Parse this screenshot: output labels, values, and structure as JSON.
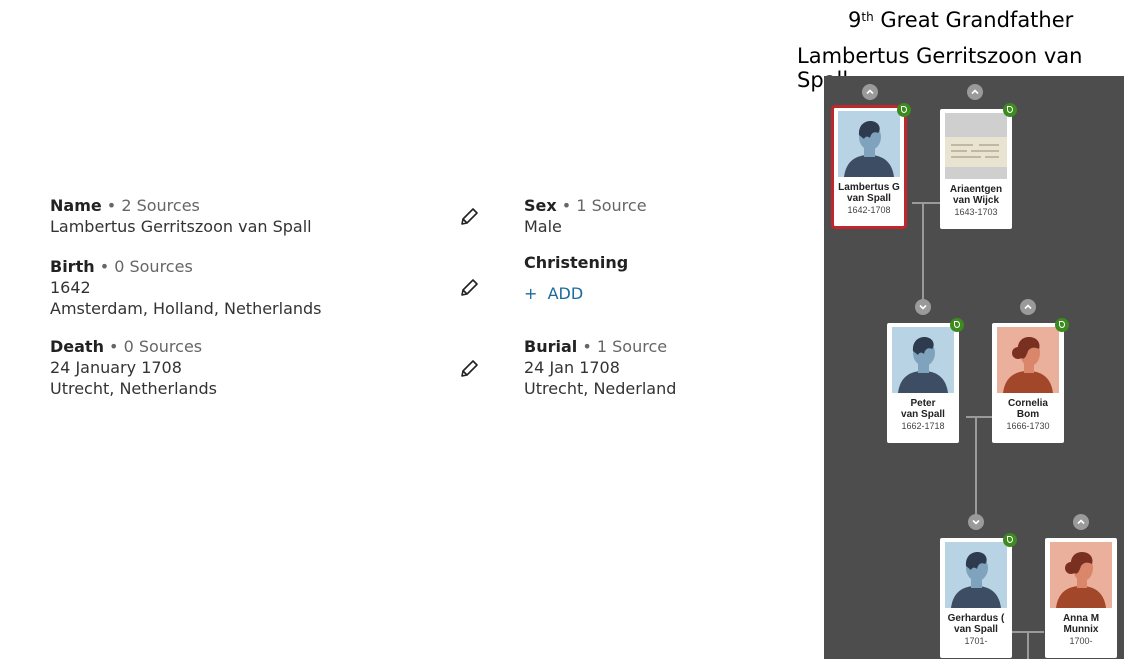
{
  "header": {
    "relation_number": "9",
    "relation_suffix": "th",
    "relation_rest": " Great Grandfather",
    "person_name": "Lambertus Gerritszoon van Spall"
  },
  "facts": {
    "name": {
      "label": "Name",
      "sources": " • 2 Sources",
      "value": "Lambertus Gerritszoon van Spall"
    },
    "birth": {
      "label": "Birth",
      "sources": " • 0 Sources",
      "date": "1642",
      "place": "Amsterdam, Holland, Netherlands"
    },
    "death": {
      "label": "Death",
      "sources": " • 0 Sources",
      "date": "24 January 1708",
      "place": "Utrecht, Netherlands"
    },
    "sex": {
      "label": "Sex",
      "sources": " • 1 Source",
      "value": "Male"
    },
    "christening": {
      "label": "Christening",
      "add_label": "+  ADD"
    },
    "burial": {
      "label": "Burial",
      "sources": " • 1 Source",
      "date": "24 Jan 1708",
      "place": "Utrecht, Nederland"
    }
  },
  "tree": {
    "cards": [
      {
        "line1": "Lambertus G",
        "line2": "van Spall",
        "years": "1642-1708",
        "gender": "male",
        "selected": true
      },
      {
        "line1": "Ariaentgen",
        "line2": "van Wijck",
        "years": "1643-1703",
        "gender": "document"
      },
      {
        "line1": "Peter",
        "line2": "van Spall",
        "years": "1662-1718",
        "gender": "male"
      },
      {
        "line1": "Cornelia",
        "line2": "Bom",
        "years": "1666-1730",
        "gender": "female"
      },
      {
        "line1": "Gerhardus (",
        "line2": "van Spall",
        "years": "1701-",
        "gender": "male"
      },
      {
        "line1": "Anna M",
        "line2": "Munnix",
        "years": "1700-",
        "gender": "female"
      }
    ]
  },
  "colors": {
    "tree_background": "#4d4d4d",
    "selected_outline": "#c0272d",
    "hint_leaf": "#3d8b1f",
    "add_link": "#1c6b9c"
  },
  "icons": [
    "pencil-icon",
    "leaf-hint-icon",
    "chevron-up-icon",
    "chevron-down-icon",
    "male-avatar-icon",
    "female-avatar-icon"
  ]
}
